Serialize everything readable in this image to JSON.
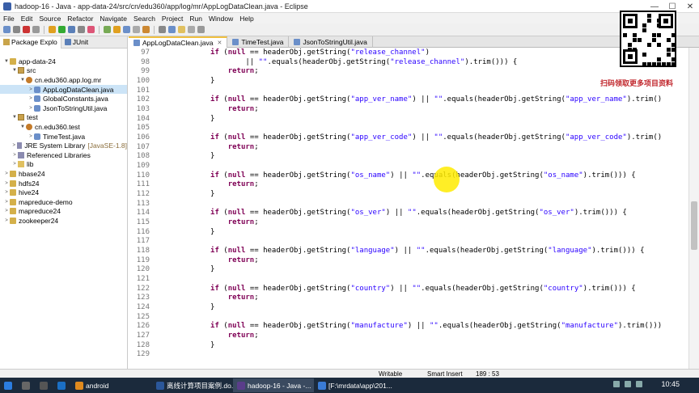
{
  "window": {
    "title": "hadoop-16 - Java - app-data-24/src/cn/edu360/app/log/mr/AppLogDataClean.java - Eclipse",
    "controls": [
      "—",
      "☐",
      "✕"
    ]
  },
  "menu": [
    "File",
    "Edit",
    "Source",
    "Refactor",
    "Navigate",
    "Search",
    "Project",
    "Run",
    "Window",
    "Help"
  ],
  "left_tabs": [
    {
      "label": "Package Explo",
      "active": true
    },
    {
      "label": "JUnit",
      "active": false
    }
  ],
  "tree": [
    {
      "indent": 0,
      "arrow": "▼",
      "icon": "proj",
      "label": "app-data-24"
    },
    {
      "indent": 1,
      "arrow": "▼",
      "icon": "src",
      "label": "src"
    },
    {
      "indent": 2,
      "arrow": "▼",
      "icon": "pkg",
      "label": "cn.edu360.app.log.mr"
    },
    {
      "indent": 3,
      "arrow": ">",
      "icon": "java",
      "label": "AppLogDataClean.java",
      "selected": true
    },
    {
      "indent": 3,
      "arrow": ">",
      "icon": "java",
      "label": "GlobalConstants.java"
    },
    {
      "indent": 3,
      "arrow": ">",
      "icon": "java",
      "label": "JsonToStringUtil.java"
    },
    {
      "indent": 1,
      "arrow": "▼",
      "icon": "src",
      "label": "test"
    },
    {
      "indent": 2,
      "arrow": "▼",
      "icon": "pkg",
      "label": "cn.edu360.test"
    },
    {
      "indent": 3,
      "arrow": ">",
      "icon": "java",
      "label": "TimeTest.java"
    },
    {
      "indent": 1,
      "arrow": ">",
      "icon": "lib",
      "label": "JRE System Library",
      "suffix": "[JavaSE-1.8]"
    },
    {
      "indent": 1,
      "arrow": ">",
      "icon": "lib",
      "label": "Referenced Libraries"
    },
    {
      "indent": 1,
      "arrow": ">",
      "icon": "fold",
      "label": "lib"
    },
    {
      "indent": 0,
      "arrow": ">",
      "icon": "proj",
      "label": "hbase24"
    },
    {
      "indent": 0,
      "arrow": ">",
      "icon": "proj",
      "label": "hdfs24"
    },
    {
      "indent": 0,
      "arrow": ">",
      "icon": "proj",
      "label": "hive24"
    },
    {
      "indent": 0,
      "arrow": ">",
      "icon": "proj",
      "label": "mapreduce-demo"
    },
    {
      "indent": 0,
      "arrow": ">",
      "icon": "proj",
      "label": "mapreduce24"
    },
    {
      "indent": 0,
      "arrow": ">",
      "icon": "proj",
      "label": "zookeeper24"
    }
  ],
  "editor_tabs": [
    {
      "label": "AppLogDataClean.java",
      "active": true
    },
    {
      "label": "TimeTest.java",
      "active": false
    },
    {
      "label": "JsonToStringUtil.java",
      "active": false
    }
  ],
  "code_lines": [
    {
      "n": "97",
      "segs": [
        [
          "k",
          "            if (null == headerObj.getString("
        ],
        [
          "s",
          "\"release_channel\""
        ],
        [
          "t",
          ")"
        ]
      ]
    },
    {
      "n": "98",
      "segs": [
        [
          "t",
          "                    || "
        ],
        [
          "s",
          "\"\""
        ],
        [
          "t",
          ".equals(headerObj.getString("
        ],
        [
          "s",
          "\"release_channel\""
        ],
        [
          "t",
          ").trim())) {"
        ]
      ]
    },
    {
      "n": "99",
      "segs": [
        [
          "k",
          "                return"
        ],
        [
          "t",
          ";"
        ]
      ]
    },
    {
      "n": "100",
      "segs": [
        [
          "t",
          "            }"
        ]
      ]
    },
    {
      "n": "101",
      "segs": [
        [
          "t",
          ""
        ]
      ]
    },
    {
      "n": "102",
      "segs": [
        [
          "k",
          "            if"
        ],
        [
          "t",
          " ("
        ],
        [
          "k",
          "null"
        ],
        [
          "t",
          " == headerObj.getString("
        ],
        [
          "s",
          "\"app_ver_name\""
        ],
        [
          "t",
          ") || "
        ],
        [
          "s",
          "\"\""
        ],
        [
          "t",
          ".equals(headerObj.getString("
        ],
        [
          "s",
          "\"app_ver_name\""
        ],
        [
          "t",
          ").trim()"
        ]
      ]
    },
    {
      "n": "103",
      "segs": [
        [
          "k",
          "                return"
        ],
        [
          "t",
          ";"
        ]
      ]
    },
    {
      "n": "104",
      "segs": [
        [
          "t",
          "            }"
        ]
      ]
    },
    {
      "n": "105",
      "segs": [
        [
          "t",
          ""
        ]
      ]
    },
    {
      "n": "106",
      "segs": [
        [
          "k",
          "            if"
        ],
        [
          "t",
          " ("
        ],
        [
          "k",
          "null"
        ],
        [
          "t",
          " == headerObj.getString("
        ],
        [
          "s",
          "\"app_ver_code\""
        ],
        [
          "t",
          ") || "
        ],
        [
          "s",
          "\"\""
        ],
        [
          "t",
          ".equals(headerObj.getString("
        ],
        [
          "s",
          "\"app_ver_code\""
        ],
        [
          "t",
          ").trim()"
        ]
      ]
    },
    {
      "n": "107",
      "segs": [
        [
          "k",
          "                return"
        ],
        [
          "t",
          ";"
        ]
      ]
    },
    {
      "n": "108",
      "segs": [
        [
          "t",
          "            }"
        ]
      ]
    },
    {
      "n": "109",
      "segs": [
        [
          "t",
          ""
        ]
      ]
    },
    {
      "n": "110",
      "segs": [
        [
          "k",
          "            if"
        ],
        [
          "t",
          " ("
        ],
        [
          "k",
          "null"
        ],
        [
          "t",
          " == headerObj.getString("
        ],
        [
          "s",
          "\"os_name\""
        ],
        [
          "t",
          ") || "
        ],
        [
          "s",
          "\"\""
        ],
        [
          "t",
          ".equals(headerObj.getString("
        ],
        [
          "s",
          "\"os_name\""
        ],
        [
          "t",
          ").trim())) {"
        ]
      ]
    },
    {
      "n": "111",
      "segs": [
        [
          "k",
          "                return"
        ],
        [
          "t",
          ";"
        ]
      ]
    },
    {
      "n": "112",
      "segs": [
        [
          "t",
          "            }"
        ]
      ]
    },
    {
      "n": "113",
      "segs": [
        [
          "t",
          ""
        ]
      ]
    },
    {
      "n": "114",
      "segs": [
        [
          "k",
          "            if"
        ],
        [
          "t",
          " ("
        ],
        [
          "k",
          "null"
        ],
        [
          "t",
          " == headerObj.getString("
        ],
        [
          "s",
          "\"os_ver\""
        ],
        [
          "t",
          ") || "
        ],
        [
          "s",
          "\"\""
        ],
        [
          "t",
          ".equals(headerObj.getString("
        ],
        [
          "s",
          "\"os_ver\""
        ],
        [
          "t",
          ").trim())) {"
        ]
      ]
    },
    {
      "n": "115",
      "segs": [
        [
          "k",
          "                return"
        ],
        [
          "t",
          ";"
        ]
      ]
    },
    {
      "n": "116",
      "segs": [
        [
          "t",
          "            }"
        ]
      ]
    },
    {
      "n": "117",
      "segs": [
        [
          "t",
          ""
        ]
      ]
    },
    {
      "n": "118",
      "segs": [
        [
          "k",
          "            if"
        ],
        [
          "t",
          " ("
        ],
        [
          "k",
          "null"
        ],
        [
          "t",
          " == headerObj.getString("
        ],
        [
          "s",
          "\"language\""
        ],
        [
          "t",
          ") || "
        ],
        [
          "s",
          "\"\""
        ],
        [
          "t",
          ".equals(headerObj.getString("
        ],
        [
          "s",
          "\"language\""
        ],
        [
          "t",
          ").trim())) {"
        ]
      ]
    },
    {
      "n": "119",
      "segs": [
        [
          "k",
          "                return"
        ],
        [
          "t",
          ";"
        ]
      ]
    },
    {
      "n": "120",
      "segs": [
        [
          "t",
          "            }"
        ]
      ]
    },
    {
      "n": "121",
      "segs": [
        [
          "t",
          ""
        ]
      ]
    },
    {
      "n": "122",
      "segs": [
        [
          "k",
          "            if"
        ],
        [
          "t",
          " ("
        ],
        [
          "k",
          "null"
        ],
        [
          "t",
          " == headerObj.getString("
        ],
        [
          "s",
          "\"country\""
        ],
        [
          "t",
          ") || "
        ],
        [
          "s",
          "\"\""
        ],
        [
          "t",
          ".equals(headerObj.getString("
        ],
        [
          "s",
          "\"country\""
        ],
        [
          "t",
          ").trim())) {"
        ]
      ]
    },
    {
      "n": "123",
      "segs": [
        [
          "k",
          "                return"
        ],
        [
          "t",
          ";"
        ]
      ]
    },
    {
      "n": "124",
      "segs": [
        [
          "t",
          "            }"
        ]
      ]
    },
    {
      "n": "125",
      "segs": [
        [
          "t",
          ""
        ]
      ]
    },
    {
      "n": "126",
      "segs": [
        [
          "k",
          "            if"
        ],
        [
          "t",
          " ("
        ],
        [
          "k",
          "null"
        ],
        [
          "t",
          " == headerObj.getString("
        ],
        [
          "s",
          "\"manufacture\""
        ],
        [
          "t",
          ") || "
        ],
        [
          "s",
          "\"\""
        ],
        [
          "t",
          ".equals(headerObj.getString("
        ],
        [
          "s",
          "\"manufacture\""
        ],
        [
          "t",
          ").trim()))"
        ]
      ]
    },
    {
      "n": "127",
      "segs": [
        [
          "k",
          "                return"
        ],
        [
          "t",
          ";"
        ]
      ]
    },
    {
      "n": "128",
      "segs": [
        [
          "t",
          "            }"
        ]
      ]
    },
    {
      "n": "129",
      "segs": [
        [
          "t",
          ""
        ]
      ]
    }
  ],
  "promo_text": "扫码领取更多项目资料",
  "status": {
    "writable": "Writable",
    "insert_mode": "Smart Insert",
    "position": "189 : 53"
  },
  "taskbar": {
    "items": [
      {
        "label": "",
        "color": "#2b7de0",
        "icon": "windows-start-icon"
      },
      {
        "label": "",
        "color": "#666",
        "icon": "search-icon"
      },
      {
        "label": "",
        "color": "#555",
        "icon": "task-view-icon"
      },
      {
        "label": "",
        "color": "#1b6fc4",
        "icon": "browser-icon"
      },
      {
        "label": "android",
        "color": "#e08a1e",
        "icon": "folder-icon"
      },
      {
        "label": "离线计算项目案例.do...",
        "color": "#2b579a",
        "icon": "word-icon"
      },
      {
        "label": "hadoop-16 - Java -...",
        "color": "#5a3d8a",
        "icon": "eclipse-icon",
        "active": true
      },
      {
        "label": "[F:\\mrdata\\app\\201...",
        "color": "#3a7bd5",
        "icon": "explorer-icon"
      }
    ],
    "time": "10:45"
  },
  "colors": {
    "keyword": "#7f0055",
    "string": "#2a00ff",
    "linenum": "#787878",
    "highlight": "#ffeb00",
    "taskbar": "#1b2a3c"
  }
}
